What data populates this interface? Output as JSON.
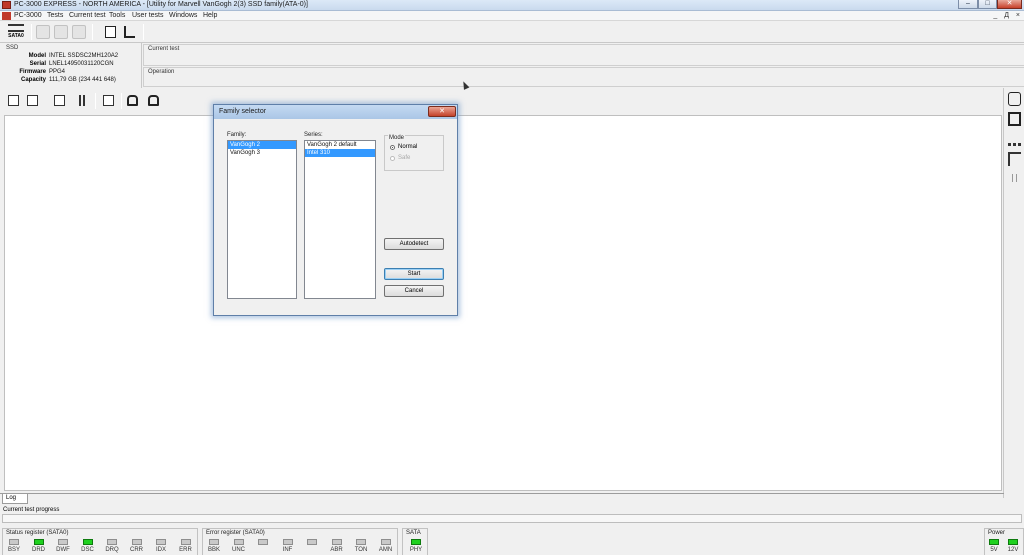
{
  "window": {
    "title": "PC-3000 EXPRESS - NORTH AMERICA - [Utility for Marvell VanGogh 2(3) SSD family(ATA-0)]",
    "min_label": "–",
    "max_label": "□",
    "close_label": "✕"
  },
  "menu": {
    "items": [
      "PC-3000",
      "Tests",
      "Current test",
      "Tools",
      "User tests",
      "Windows",
      "Help"
    ],
    "mdi_controls": [
      "_",
      "Д",
      "×"
    ]
  },
  "toolbar": {
    "sata_label": "SATA0"
  },
  "ssd": {
    "section_title": "SSD",
    "fields": [
      {
        "label": "Model",
        "value": "INTEL SSDSC2MH120A2"
      },
      {
        "label": "Serial",
        "value": "LNEL14950031120CGN"
      },
      {
        "label": "Firmware",
        "value": "PPG4"
      },
      {
        "label": "Capacity",
        "value": "111,79 GB (234 441 648)"
      }
    ]
  },
  "panels": {
    "current_test_title": "Current test",
    "operation_title": "Operation"
  },
  "log": {
    "tab_label": "Log"
  },
  "progress": {
    "label": "Current test progress"
  },
  "status_register": {
    "title": "Status register (SATA0)",
    "leds": [
      {
        "label": "BSY",
        "on": false
      },
      {
        "label": "DRD",
        "on": true
      },
      {
        "label": "DWF",
        "on": false
      },
      {
        "label": "DSC",
        "on": true
      },
      {
        "label": "DRQ",
        "on": false
      },
      {
        "label": "CRR",
        "on": false
      },
      {
        "label": "IDX",
        "on": false
      },
      {
        "label": "ERR",
        "on": false
      }
    ]
  },
  "error_register": {
    "title": "Error register (SATA0)",
    "leds": [
      {
        "label": "BBK",
        "on": false
      },
      {
        "label": "UNC",
        "on": false
      },
      {
        "label": "",
        "on": false
      },
      {
        "label": "INF",
        "on": false
      },
      {
        "label": "",
        "on": false
      },
      {
        "label": "ABR",
        "on": false
      },
      {
        "label": "TON",
        "on": false
      },
      {
        "label": "AMN",
        "on": false
      }
    ]
  },
  "sata": {
    "title": "SATA",
    "leds": [
      {
        "label": "PHY",
        "on": true
      }
    ]
  },
  "power": {
    "title": "Power",
    "leds": [
      {
        "label": "5V",
        "on": true
      },
      {
        "label": "12V",
        "on": true
      }
    ]
  },
  "dialog": {
    "title": "Family selector",
    "close_label": "✕",
    "family_label": "Family:",
    "families": [
      {
        "name": "VanGogh 2",
        "selected": true
      },
      {
        "name": "VanGogh 3",
        "selected": false
      }
    ],
    "series_label": "Series:",
    "series": [
      {
        "name": "VanGogh 2 default",
        "selected": false
      },
      {
        "name": "Intel 310",
        "selected": true
      }
    ],
    "mode_label": "Mode",
    "mode_options": [
      {
        "name": "Normal",
        "checked": true,
        "enabled": true
      },
      {
        "name": "Safe",
        "checked": false,
        "enabled": false
      }
    ],
    "autodetect_label": "Autodetect",
    "start_label": "Start",
    "cancel_label": "Cancel"
  },
  "colors": {
    "led_on": "#1fd11f",
    "led_off": "#c9c9c9",
    "selection": "#3399ff",
    "close_button": "#c7412a"
  }
}
